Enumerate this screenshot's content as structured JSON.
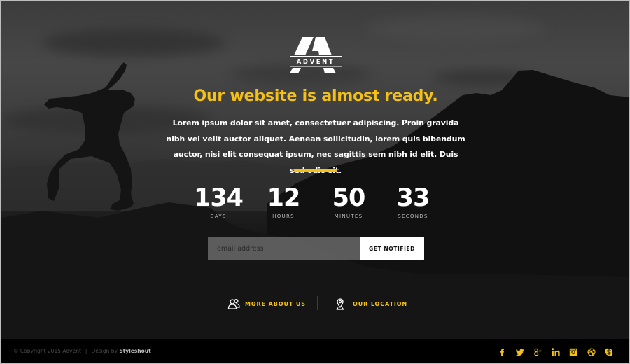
{
  "brand": {
    "logo_text": "ADVENT"
  },
  "hero": {
    "headline": "Our website is almost ready.",
    "intro": "Lorem ipsum dolor sit amet, consectetuer adipiscing. Proin gravida nibh vel velit auctor aliquet. Aenean sollicitudin, lorem quis bibendum auctor, nisi elit consequat ipsum, nec sagittis sem nibh id elit. Duis sed odio sit."
  },
  "countdown": [
    {
      "value": "134",
      "label": "DAYS"
    },
    {
      "value": "12",
      "label": "HOURS"
    },
    {
      "value": "50",
      "label": "MINUTES"
    },
    {
      "value": "33",
      "label": "SECONDS"
    }
  ],
  "signup": {
    "email_placeholder": "email address",
    "email_value": "",
    "button_label": "GET NOTIFIED"
  },
  "links": [
    {
      "label": "MORE ABOUT US",
      "icon": "users-icon"
    },
    {
      "label": "OUR LOCATION",
      "icon": "map-pin-icon"
    }
  ],
  "footer": {
    "copyright": "© Copyright 2015 Advent",
    "separator": "|",
    "design_prefix": "Design by",
    "design_brand": "Styleshout",
    "social": [
      {
        "name": "facebook",
        "icon": "facebook-icon"
      },
      {
        "name": "twitter",
        "icon": "twitter-icon"
      },
      {
        "name": "google-plus",
        "icon": "google-plus-icon"
      },
      {
        "name": "linkedin",
        "icon": "linkedin-icon"
      },
      {
        "name": "instagram",
        "icon": "instagram-icon"
      },
      {
        "name": "dribbble",
        "icon": "dribbble-icon"
      },
      {
        "name": "skype",
        "icon": "skype-icon"
      }
    ]
  },
  "colors": {
    "accent": "#f6c115",
    "footer_bg": "#000000",
    "text_light": "#ffffff"
  }
}
